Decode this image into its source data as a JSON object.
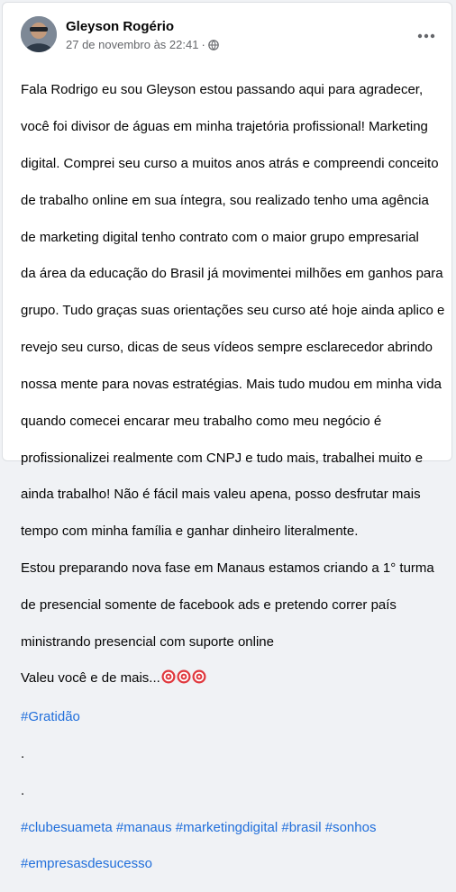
{
  "post": {
    "author": "Gleyson Rogério",
    "timestamp": "27 de novembro às 22:41",
    "separator": "·",
    "audience_icon": "globe-icon",
    "more_icon": "more-horizontal-icon",
    "text_lines": [
      "Fala Rodrigo eu sou Gleyson estou passando aqui para agradecer,",
      "você foi divisor de águas em minha trajetória profissional! Marketing",
      "digital. Comprei seu curso a muitos anos atrás e compreendi conceito",
      "de trabalho online em sua íntegra, sou realizado tenho uma agência",
      "de marketing digital tenho contrato com o maior grupo empresarial",
      "da área da educação do Brasil já movimentei milhões em ganhos para",
      "grupo. Tudo graças suas orientações seu curso até hoje ainda aplico e",
      "revejo seu curso, dicas de seus vídeos sempre esclarecedor abrindo",
      "nossa mente para novas estratégias. Mais tudo mudou em minha vida",
      "quando comecei encarar meu trabalho como meu negócio é",
      "profissionalizei realmente com CNPJ e tudo mais, trabalhei muito e",
      "ainda trabalho! Não é fácil mais valeu apena,  posso desfrutar mais",
      "tempo com minha família e ganhar dinheiro literalmente.",
      "Estou preparando nova fase em Manaus estamos criando a 1° turma",
      "de presencial somente de facebook ads e pretendo correr país",
      "ministrando presencial com suporte online"
    ],
    "closing_line": "Valeu você e de mais...",
    "closing_icons": [
      "target-icon",
      "target-icon",
      "target-icon"
    ],
    "hashtag_gratidao": "#Gratidão",
    "dot_1": ".",
    "dot_2": ".",
    "hashtags_line_1": [
      "#clubesuameta",
      "#manaus",
      "#marketingdigital",
      "#brasil",
      "#sonhos"
    ],
    "hashtags_line_2": [
      "#empresasdesucesso"
    ]
  },
  "colors": {
    "text": "#050505",
    "meta": "#65676b",
    "hashtag": "#216fdb",
    "target_red": "#e0383e"
  }
}
